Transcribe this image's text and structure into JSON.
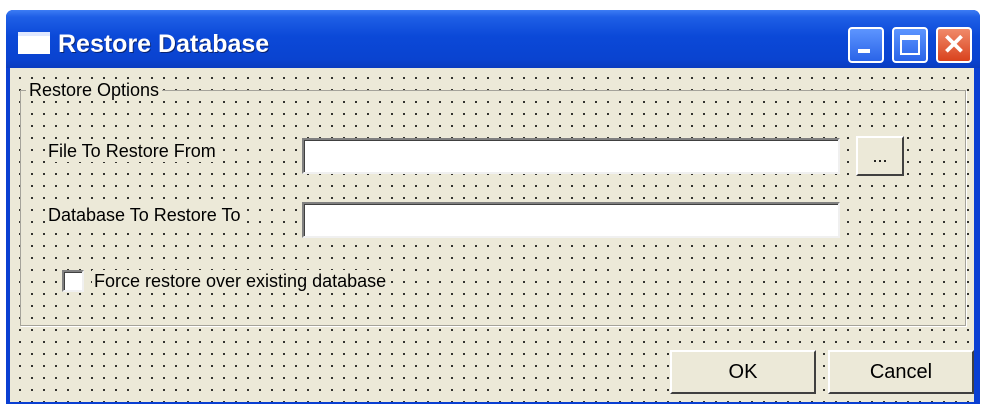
{
  "window": {
    "title": "Restore Database",
    "colors": {
      "titlebar": "#0a43d0",
      "client": "#ece9d8",
      "close_button": "#d9421d"
    },
    "icons": {
      "app": "window-icon",
      "minimize": "minimize-icon",
      "maximize": "maximize-icon",
      "close": "close-icon"
    },
    "close_glyph": "✕"
  },
  "restore_options": {
    "legend": "Restore Options",
    "file_label": "File To Restore From",
    "file_value": "",
    "browse_label": "...",
    "database_label": "Database To Restore To",
    "database_value": "",
    "force_label": "Force restore over existing database",
    "force_checked": false
  },
  "buttons": {
    "ok": "OK",
    "cancel": "Cancel"
  }
}
